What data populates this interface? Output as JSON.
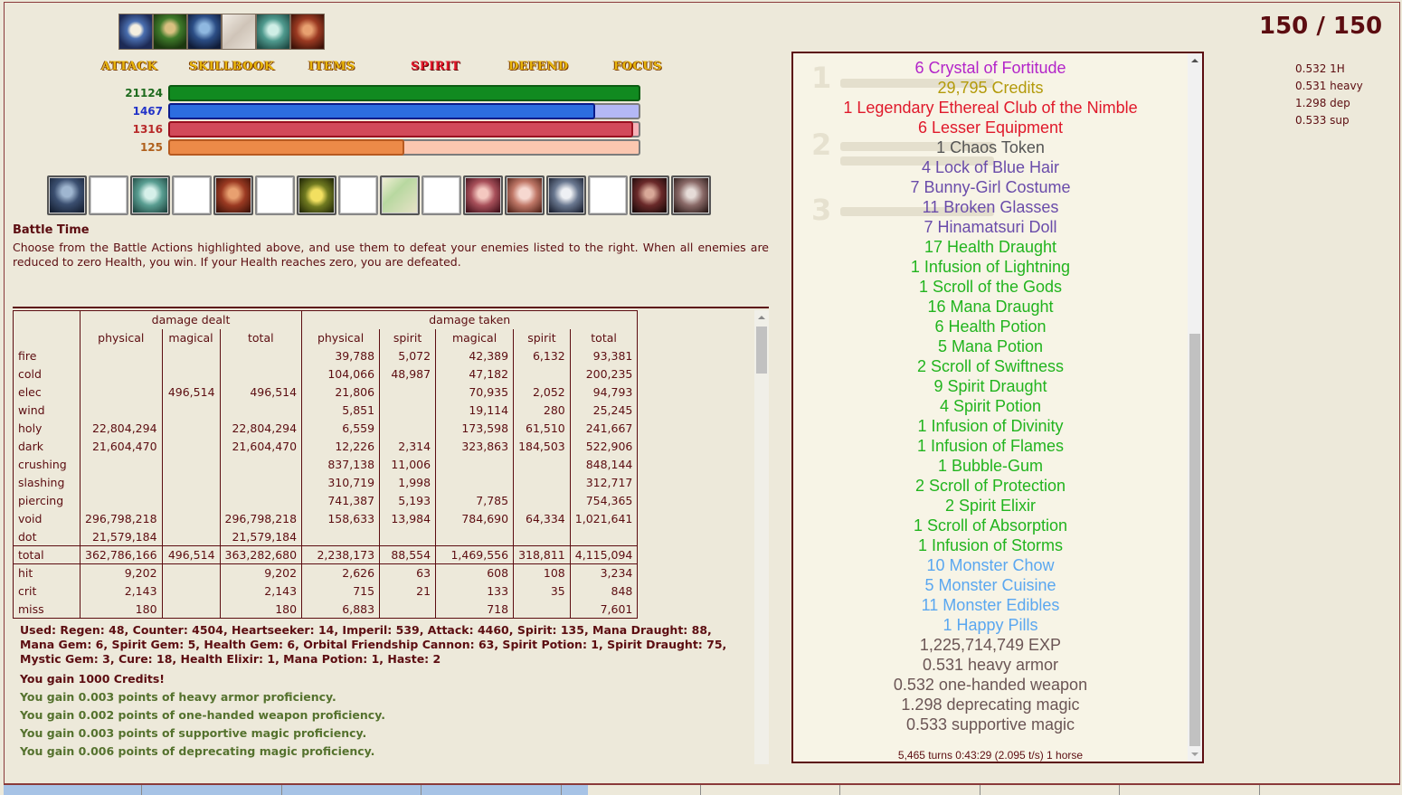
{
  "party": [
    "hero-portrait-1",
    "hero-portrait-2",
    "hero-portrait-3",
    "hero-portrait-4",
    "hero-portrait-5",
    "hero-portrait-6"
  ],
  "actions": {
    "attack": "ATTACK",
    "skillbook": "SKILLBOOK",
    "items": "ITEMS",
    "spirit": "SPIRIT",
    "defend": "DEFEND",
    "focus": "FOCUS"
  },
  "bars": {
    "hp": {
      "value": "21124",
      "fill": 1.0,
      "color": "#118a20",
      "track": "#118a20"
    },
    "mp": {
      "value": "1467",
      "fill": 0.905,
      "color": "#2c6de0",
      "track": "#b4b8f5"
    },
    "sp": {
      "value": "1316",
      "fill": 0.985,
      "color": "#d24a5a",
      "track": "#f6b2b8"
    },
    "oc": {
      "value": "125",
      "fill": 0.5,
      "color": "#ec8a48",
      "track": "#fbc7b0"
    }
  },
  "effects": [
    "berserk-icon",
    "",
    "spirit-shield-icon",
    "",
    "protection-icon",
    "",
    "haste-icon",
    "",
    "regen-icon",
    "",
    "heartseeker-icon",
    "absorb-icon",
    "spark-of-life-icon",
    "",
    "channeling-icon",
    "shadow-veil-icon"
  ],
  "battle": {
    "title": "Battle Time",
    "description": "Choose from the Battle Actions highlighted above, and use them to defeat your enemies listed to the right. When all enemies are reduced to zero Health, you win. If your Health reaches zero, you are defeated."
  },
  "stats": {
    "group_dealt": "damage dealt",
    "group_taken": "damage taken",
    "columns": [
      "physical",
      "magical",
      "total",
      "physical",
      "spirit",
      "magical",
      "spirit",
      "total"
    ],
    "rows": [
      [
        "fire",
        "",
        "",
        "",
        "39,788",
        "5,072",
        "42,389",
        "6,132",
        "93,381"
      ],
      [
        "cold",
        "",
        "",
        "",
        "104,066",
        "48,987",
        "47,182",
        "",
        "200,235"
      ],
      [
        "elec",
        "",
        "496,514",
        "496,514",
        "21,806",
        "",
        "70,935",
        "2,052",
        "94,793"
      ],
      [
        "wind",
        "",
        "",
        "",
        "5,851",
        "",
        "19,114",
        "280",
        "25,245"
      ],
      [
        "holy",
        "22,804,294",
        "",
        "22,804,294",
        "6,559",
        "",
        "173,598",
        "61,510",
        "241,667"
      ],
      [
        "dark",
        "21,604,470",
        "",
        "21,604,470",
        "12,226",
        "2,314",
        "323,863",
        "184,503",
        "522,906"
      ],
      [
        "crushing",
        "",
        "",
        "",
        "837,138",
        "11,006",
        "",
        "",
        "848,144"
      ],
      [
        "slashing",
        "",
        "",
        "",
        "310,719",
        "1,998",
        "",
        "",
        "312,717"
      ],
      [
        "piercing",
        "",
        "",
        "",
        "741,387",
        "5,193",
        "7,785",
        "",
        "754,365"
      ],
      [
        "void",
        "296,798,218",
        "",
        "296,798,218",
        "158,633",
        "13,984",
        "784,690",
        "64,334",
        "1,021,641"
      ],
      [
        "dot",
        "21,579,184",
        "",
        "21,579,184",
        "",
        "",
        "",
        "",
        ""
      ],
      [
        "total",
        "362,786,166",
        "496,514",
        "363,282,680",
        "2,238,173",
        "88,554",
        "1,469,556",
        "318,811",
        "4,115,094"
      ]
    ],
    "rows2": [
      [
        "hit",
        "9,202",
        "",
        "9,202",
        "2,626",
        "63",
        "608",
        "108",
        "3,234"
      ],
      [
        "crit",
        "2,143",
        "",
        "2,143",
        "715",
        "21",
        "133",
        "35",
        "848"
      ],
      [
        "miss",
        "180",
        "",
        "180",
        "6,883",
        "",
        "718",
        "",
        "7,601"
      ]
    ]
  },
  "log": {
    "used": "Used: Regen: 48, Counter: 4504, Heartseeker: 14, Imperil: 539, Attack: 4460, Spirit: 135, Mana Draught: 88, Mana Gem: 6, Spirit Gem: 5, Health Gem: 6, Orbital Friendship Cannon: 63, Spirit Potion: 1, Spirit Draught: 75, Mystic Gem: 3, Cure: 18, Health Elixir: 1, Mana Potion: 1, Haste: 2",
    "credits": "You gain 1000 Credits!",
    "p1": "You gain 0.003 points of heavy armor proficiency.",
    "p2": "You gain 0.002 points of one-handed weapon proficiency.",
    "p3": "You gain 0.003 points of supportive magic proficiency.",
    "p4": "You gain 0.006 points of deprecating magic proficiency."
  },
  "hp_count": "150 / 150",
  "mini_prof": [
    "0.532 1H",
    "0.531 heavy",
    "1.298 dep",
    "0.533 sup"
  ],
  "drops": [
    {
      "text": "6 Crystal of Fortitude",
      "cls": "c-purple"
    },
    {
      "text": "29,795 Credits",
      "cls": "c-gold"
    },
    {
      "text": "1 Legendary Ethereal Club of the Nimble",
      "cls": "c-red"
    },
    {
      "text": "6 Lesser Equipment",
      "cls": "c-red"
    },
    {
      "text": "1 Chaos Token",
      "cls": "c-dark"
    },
    {
      "text": "4 Lock of Blue Hair",
      "cls": "c-indigo"
    },
    {
      "text": "7 Bunny-Girl Costume",
      "cls": "c-indigo"
    },
    {
      "text": "11 Broken Glasses",
      "cls": "c-indigo"
    },
    {
      "text": "7 Hinamatsuri Doll",
      "cls": "c-indigo"
    },
    {
      "text": "17 Health Draught",
      "cls": "c-green"
    },
    {
      "text": "1 Infusion of Lightning",
      "cls": "c-green"
    },
    {
      "text": "1 Scroll of the Gods",
      "cls": "c-green"
    },
    {
      "text": "16 Mana Draught",
      "cls": "c-green"
    },
    {
      "text": "6 Health Potion",
      "cls": "c-green"
    },
    {
      "text": "5 Mana Potion",
      "cls": "c-green"
    },
    {
      "text": "2 Scroll of Swiftness",
      "cls": "c-green"
    },
    {
      "text": "9 Spirit Draught",
      "cls": "c-green"
    },
    {
      "text": "4 Spirit Potion",
      "cls": "c-green"
    },
    {
      "text": "1 Infusion of Divinity",
      "cls": "c-green"
    },
    {
      "text": "1 Infusion of Flames",
      "cls": "c-green"
    },
    {
      "text": "1 Bubble-Gum",
      "cls": "c-green"
    },
    {
      "text": "2 Scroll of Protection",
      "cls": "c-green"
    },
    {
      "text": "2 Spirit Elixir",
      "cls": "c-green"
    },
    {
      "text": "1 Scroll of Absorption",
      "cls": "c-green"
    },
    {
      "text": "1 Infusion of Storms",
      "cls": "c-green"
    },
    {
      "text": "10 Monster Chow",
      "cls": "c-blue"
    },
    {
      "text": "5 Monster Cuisine",
      "cls": "c-blue"
    },
    {
      "text": "11 Monster Edibles",
      "cls": "c-blue"
    },
    {
      "text": "1 Happy Pills",
      "cls": "c-blue"
    },
    {
      "text": "1,225,714,749 EXP",
      "cls": "c-brown"
    },
    {
      "text": "0.531 heavy armor",
      "cls": "c-brown"
    },
    {
      "text": "0.532 one-handed weapon",
      "cls": "c-brown"
    },
    {
      "text": "1.298 deprecating magic",
      "cls": "c-brown"
    },
    {
      "text": "0.533 supportive magic",
      "cls": "c-brown"
    }
  ],
  "panel_footer": "5,465 turns 0:43:29 (2.095 t/s) 1 horse",
  "monster_slots": [
    "1",
    "2",
    "3"
  ]
}
